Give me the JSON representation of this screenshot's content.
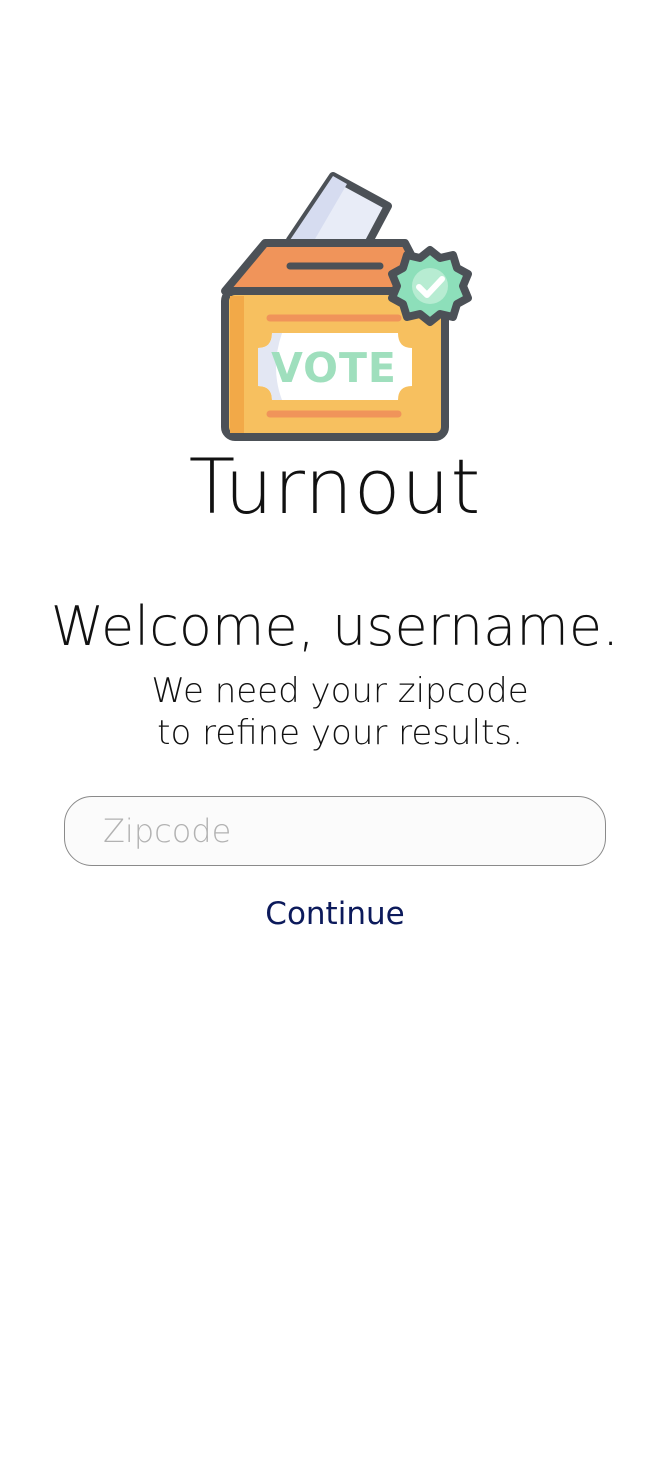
{
  "app": {
    "title": "Turnout",
    "logo_icon": "ballot-box-vote-icon",
    "logo_text": "VOTE"
  },
  "welcome": {
    "heading": "Welcome, username.",
    "subtitle": "We need your zipcode to refine your results."
  },
  "form": {
    "zipcode_placeholder": "Zipcode",
    "zipcode_value": "",
    "continue_label": "Continue"
  },
  "colors": {
    "continue_text": "#0c1a5b",
    "ballot_box_body": "#f7c05f",
    "ballot_box_lid": "#f0945a",
    "check_badge": "#8ddfba",
    "vote_text": "#9fdfbd",
    "outline": "#4c5157"
  }
}
